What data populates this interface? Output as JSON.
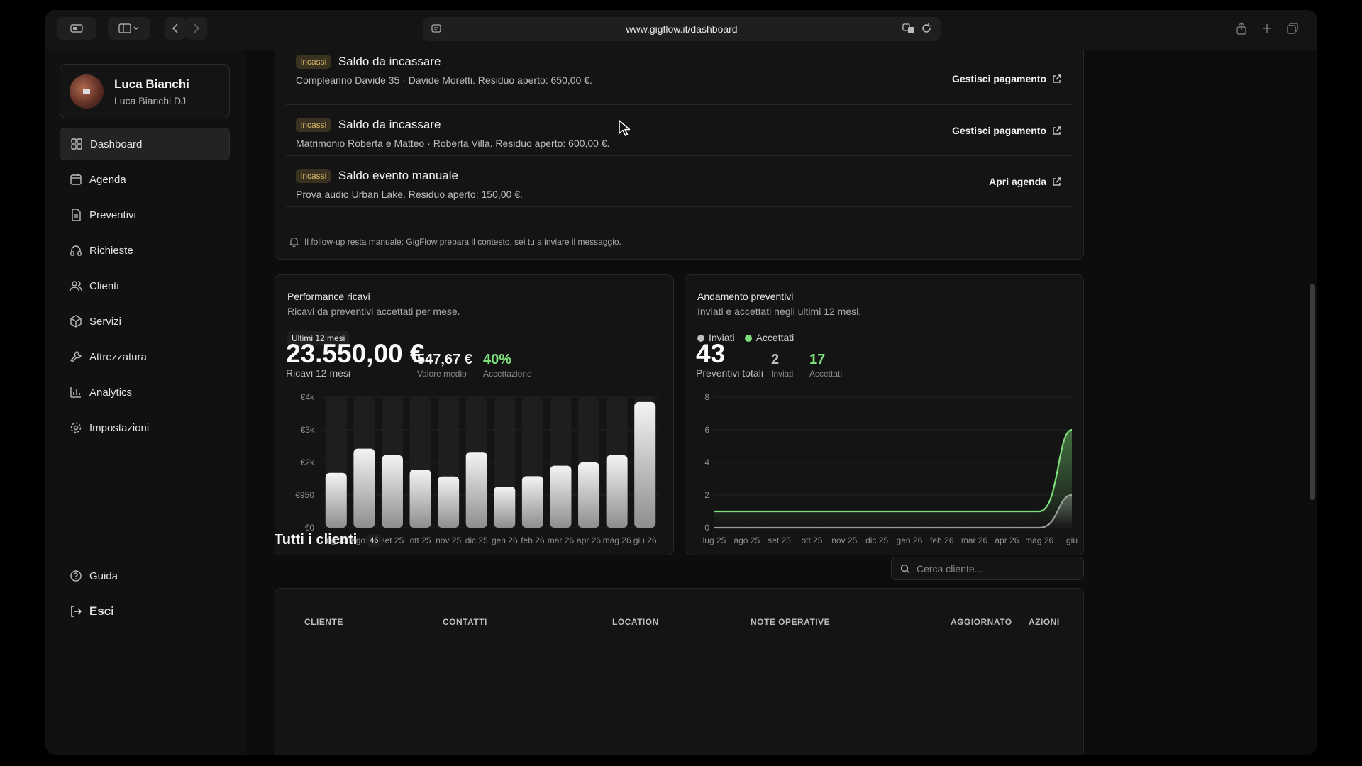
{
  "browser": {
    "url": "www.gigflow.it/dashboard"
  },
  "sidebar": {
    "profile": {
      "name": "Luca Bianchi",
      "subtitle": "Luca Bianchi DJ"
    },
    "items": [
      {
        "label": "Dashboard",
        "icon": "dashboard-icon"
      },
      {
        "label": "Agenda",
        "icon": "calendar-icon"
      },
      {
        "label": "Preventivi",
        "icon": "document-icon"
      },
      {
        "label": "Richieste",
        "icon": "headphones-icon"
      },
      {
        "label": "Clienti",
        "icon": "users-icon"
      },
      {
        "label": "Servizi",
        "icon": "box-icon"
      },
      {
        "label": "Attrezzatura",
        "icon": "wrench-icon"
      },
      {
        "label": "Analytics",
        "icon": "bar-chart-icon"
      },
      {
        "label": "Impostazioni",
        "icon": "gear-icon"
      }
    ],
    "help": "Guida",
    "logout": "Esci"
  },
  "payments": {
    "rows": [
      {
        "badge": "Incassi",
        "title": "Saldo da incassare",
        "desc": "Compleanno Davide 35 · Davide Moretti. Residuo aperto: 650,00 €.",
        "action": "Gestisci pagamento"
      },
      {
        "badge": "Incassi",
        "title": "Saldo da incassare",
        "desc": "Matrimonio Roberta e Matteo · Roberta Villa. Residuo aperto: 600,00 €.",
        "action": "Gestisci pagamento"
      },
      {
        "badge": "Incassi",
        "title": "Saldo evento manuale",
        "desc": "Prova audio Urban Lake. Residuo aperto: 150,00 €.",
        "action": "Apri agenda"
      }
    ],
    "note": "Il follow-up resta manuale: GigFlow prepara il contesto, sei tu a inviare il messaggio."
  },
  "revenue": {
    "title": "Performance ricavi",
    "subtitle": "Ricavi da preventivi accettati per mese.",
    "period": "Ultimi 12 mesi",
    "total": "23.550,00 €",
    "total_label": "Ricavi 12 mesi",
    "avg": "547,67 €",
    "avg_label": "Valore medio",
    "acceptance": "40%",
    "acceptance_label": "Accettazione"
  },
  "quotes": {
    "title": "Andamento preventivi",
    "subtitle": "Inviati e accettati negli ultimi 12 mesi.",
    "legend_sent": "Inviati",
    "legend_accepted": "Accettati",
    "total": "43",
    "total_label": "Preventivi totali",
    "sent": "2",
    "sent_label": "Inviati",
    "accepted": "17",
    "accepted_label": "Accettati"
  },
  "chart_data": [
    {
      "type": "bar",
      "categories": [
        "lug 25",
        "ago 25",
        "set 25",
        "ott 25",
        "nov 25",
        "dic 25",
        "gen 26",
        "feb 26",
        "mar 26",
        "apr 26",
        "mag 26",
        "giu 26"
      ],
      "values": [
        1680,
        2420,
        2220,
        1780,
        1570,
        2320,
        1260,
        1580,
        1900,
        2000,
        2220,
        3850
      ],
      "ytick_labels": [
        "€0",
        "€950",
        "€2k",
        "€3k",
        "€4k"
      ],
      "ytick_values": [
        0,
        1000,
        2000,
        3000,
        4000
      ],
      "ylim": [
        0,
        4000
      ],
      "grid": true
    },
    {
      "type": "line",
      "x": [
        "lug 25",
        "ago 25",
        "set 25",
        "ott 25",
        "nov 25",
        "dic 25",
        "gen 26",
        "feb 26",
        "mar 26",
        "apr 26",
        "mag 26",
        "giu"
      ],
      "series": [
        {
          "name": "Inviati",
          "color": "#9a9a9a",
          "values": [
            0,
            0,
            0,
            0,
            0,
            0,
            0,
            0,
            0,
            0,
            0,
            2
          ]
        },
        {
          "name": "Accettati",
          "color": "#7ee07a",
          "values": [
            1,
            1,
            1,
            1,
            1,
            1,
            1,
            1,
            1,
            1,
            1,
            6
          ]
        }
      ],
      "yticks": [
        0,
        2,
        4,
        6,
        8
      ],
      "ylim": [
        0,
        8
      ],
      "grid": true
    }
  ],
  "clients": {
    "title": "Tutti i clienti",
    "count": "46",
    "search_placeholder": "Cerca cliente...",
    "columns": [
      "CLIENTE",
      "CONTATTI",
      "LOCATION",
      "NOTE OPERATIVE",
      "AGGIORNATO",
      "AZIONI"
    ]
  }
}
